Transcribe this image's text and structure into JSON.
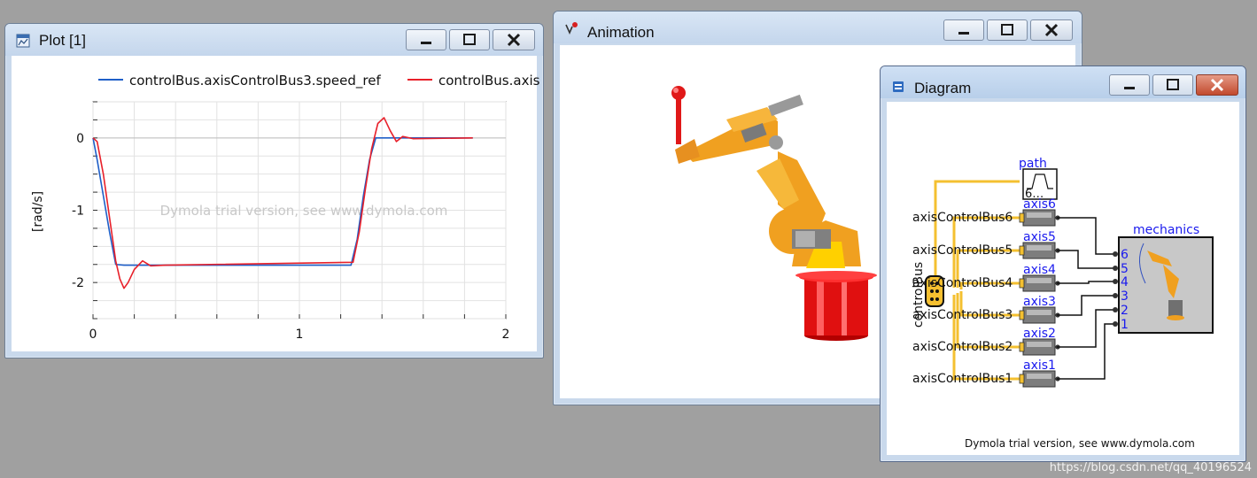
{
  "plot_window": {
    "title": "Plot [1]",
    "watermark": "Dymola trial version, see www.dymola.com",
    "ylabel": "[rad/s]",
    "legend": [
      {
        "name": "controlBus.axisControlBus3.speed_ref",
        "color": "#1f5fc8"
      },
      {
        "name": "controlBus.axis",
        "color": "#e8202a"
      }
    ],
    "chart_data": {
      "type": "line",
      "ylabel": "[rad/s]",
      "xlim": [
        0,
        2
      ],
      "ylim": [
        -2.5,
        0.5
      ],
      "xticks": [
        "0",
        "1",
        "2"
      ],
      "yticks": [
        "0",
        "-1",
        "-2"
      ],
      "grid": true,
      "legend_position": "top",
      "series": [
        {
          "name": "controlBus.axisControlBus3.speed_ref",
          "color": "#1f5fc8",
          "x": [
            0,
            0.02,
            0.05,
            0.08,
            0.11,
            0.15,
            1.25,
            1.28,
            1.31,
            1.34,
            1.37,
            1.84
          ],
          "y": [
            0,
            -0.3,
            -0.8,
            -1.3,
            -1.75,
            -1.76,
            -1.76,
            -1.4,
            -0.8,
            -0.3,
            0,
            0
          ]
        },
        {
          "name": "controlBus.axis",
          "color": "#e8202a",
          "x": [
            0,
            0.02,
            0.05,
            0.08,
            0.11,
            0.13,
            0.15,
            0.17,
            0.2,
            0.24,
            0.28,
            0.35,
            1.26,
            1.29,
            1.32,
            1.35,
            1.38,
            1.41,
            1.44,
            1.47,
            1.5,
            1.55,
            1.84
          ],
          "y": [
            0,
            -0.05,
            -0.5,
            -1.1,
            -1.7,
            -1.95,
            -2.08,
            -2.0,
            -1.82,
            -1.7,
            -1.77,
            -1.76,
            -1.72,
            -1.3,
            -0.7,
            -0.15,
            0.2,
            0.28,
            0.1,
            -0.05,
            0.02,
            -0.01,
            0
          ]
        }
      ]
    }
  },
  "animation_window": {
    "title": "Animation"
  },
  "diagram_window": {
    "title": "Diagram",
    "footer": "Dymola trial version, see www.dymola.com",
    "path_label": "path",
    "path_value": "6…",
    "bus_label": "controlBus",
    "mechanics_label": "mechanics",
    "axes": [
      {
        "bus": "axisControlBus6",
        "label": "axis6"
      },
      {
        "bus": "axisControlBus5",
        "label": "axis5"
      },
      {
        "bus": "axisControlBus4",
        "label": "axis4"
      },
      {
        "bus": "axisControlBus3",
        "label": "axis3"
      },
      {
        "bus": "axisControlBus2",
        "label": "axis2"
      },
      {
        "bus": "axisControlBus1",
        "label": "axis1"
      }
    ],
    "ports": [
      "6",
      "5",
      "4",
      "3",
      "2",
      "1"
    ]
  },
  "desktop_watermark": "https://blog.csdn.net/qq_40196524"
}
